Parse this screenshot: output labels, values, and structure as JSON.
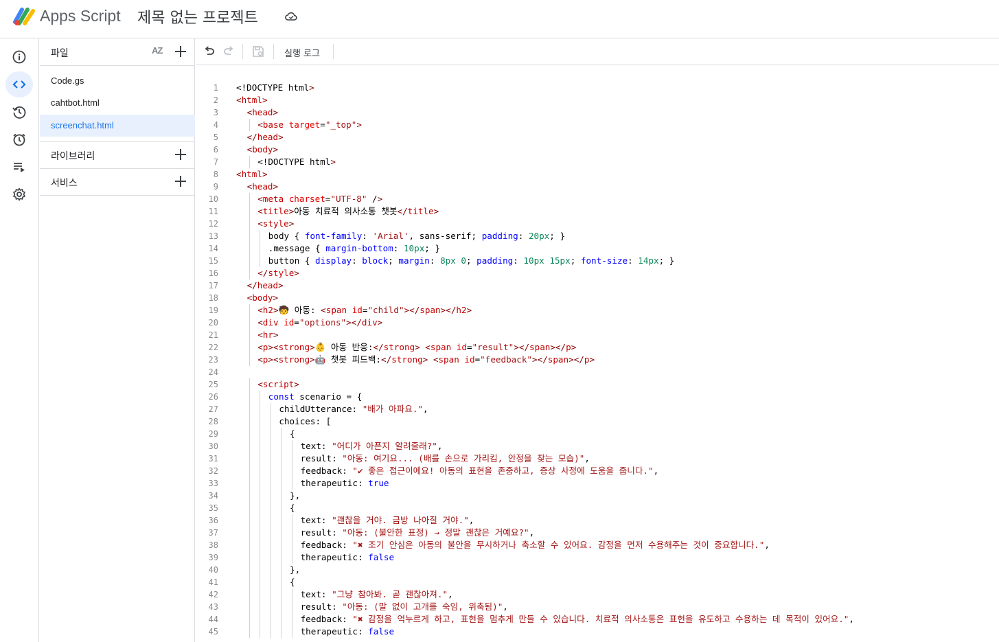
{
  "header": {
    "app_name": "Apps Script",
    "project_title": "제목 없는 프로젝트"
  },
  "rail": {
    "items": [
      {
        "name": "overview",
        "icon": "info-icon"
      },
      {
        "name": "editor",
        "icon": "code-icon",
        "active": true
      },
      {
        "name": "history",
        "icon": "history-icon"
      },
      {
        "name": "triggers",
        "icon": "alarm-icon"
      },
      {
        "name": "executions",
        "icon": "executions-icon"
      },
      {
        "name": "settings",
        "icon": "gear-icon"
      }
    ]
  },
  "files_panel": {
    "files_label": "파일",
    "sort_label": "AZ",
    "files": [
      "Code.gs",
      "cahtbot.html",
      "screenchat.html"
    ],
    "selected_file": "screenchat.html",
    "libraries_label": "라이브러리",
    "services_label": "서비스"
  },
  "toolbar": {
    "execution_log_label": "실행 로그"
  },
  "editor": {
    "lines": [
      {
        "n": "1",
        "indent": 0,
        "text": "<!DOCTYPE html>"
      },
      {
        "n": "2",
        "indent": 0,
        "text": "<html>"
      },
      {
        "n": "3",
        "indent": 1,
        "text": "<head>"
      },
      {
        "n": "4",
        "indent": 2,
        "text": "<base target=\"_top\">"
      },
      {
        "n": "5",
        "indent": 1,
        "text": "</head>"
      },
      {
        "n": "6",
        "indent": 1,
        "text": "<body>"
      },
      {
        "n": "7",
        "indent": 2,
        "text": "<!DOCTYPE html>"
      },
      {
        "n": "8",
        "indent": 0,
        "text": "<html>"
      },
      {
        "n": "9",
        "indent": 1,
        "text": "<head>"
      },
      {
        "n": "10",
        "indent": 2,
        "text": "<meta charset=\"UTF-8\" />"
      },
      {
        "n": "11",
        "indent": 2,
        "text": "<title>아동 치료적 의사소통 챗봇</title>"
      },
      {
        "n": "12",
        "indent": 2,
        "text": "<style>"
      },
      {
        "n": "13",
        "indent": 3,
        "text": "body { font-family: 'Arial', sans-serif; padding: 20px; }"
      },
      {
        "n": "14",
        "indent": 3,
        "text": ".message { margin-bottom: 10px; }"
      },
      {
        "n": "15",
        "indent": 3,
        "text": "button { display: block; margin: 8px 0; padding: 10px 15px; font-size: 14px; }"
      },
      {
        "n": "16",
        "indent": 2,
        "text": "</style>"
      },
      {
        "n": "17",
        "indent": 1,
        "text": "</head>"
      },
      {
        "n": "18",
        "indent": 1,
        "text": "<body>"
      },
      {
        "n": "19",
        "indent": 2,
        "text": "<h2>🧒 아동: <span id=\"child\"></span></h2>"
      },
      {
        "n": "20",
        "indent": 2,
        "text": "<div id=\"options\"></div>"
      },
      {
        "n": "21",
        "indent": 2,
        "text": "<hr>"
      },
      {
        "n": "22",
        "indent": 2,
        "text": "<p><strong>👶 아동 반응:</strong> <span id=\"result\"></span></p>"
      },
      {
        "n": "23",
        "indent": 2,
        "text": "<p><strong>🤖 챗봇 피드백:</strong> <span id=\"feedback\"></span></p>"
      },
      {
        "n": "24",
        "indent": 0,
        "text": ""
      },
      {
        "n": "25",
        "indent": 2,
        "text": "<script>"
      },
      {
        "n": "26",
        "indent": 3,
        "text": "const scenario = {"
      },
      {
        "n": "27",
        "indent": 4,
        "text": "childUtterance: \"배가 아파요.\","
      },
      {
        "n": "28",
        "indent": 4,
        "text": "choices: ["
      },
      {
        "n": "29",
        "indent": 5,
        "text": "{"
      },
      {
        "n": "30",
        "indent": 6,
        "text": "text: \"어디가 아픈지 알려줄래?\","
      },
      {
        "n": "31",
        "indent": 6,
        "text": "result: \"아동: 여기요... (배를 손으로 가리킴, 안정을 찾는 모습)\","
      },
      {
        "n": "32",
        "indent": 6,
        "text": "feedback: \"✔ 좋은 접근이에요! 아동의 표현을 존중하고, 증상 사정에 도움을 줍니다.\","
      },
      {
        "n": "33",
        "indent": 6,
        "text": "therapeutic: true"
      },
      {
        "n": "34",
        "indent": 5,
        "text": "},"
      },
      {
        "n": "35",
        "indent": 5,
        "text": "{"
      },
      {
        "n": "36",
        "indent": 6,
        "text": "text: \"괜찮을 거야. 금방 나아질 거야.\","
      },
      {
        "n": "37",
        "indent": 6,
        "text": "result: \"아동: (불안한 표정) → 정말 괜찮은 거예요?\","
      },
      {
        "n": "38",
        "indent": 6,
        "text": "feedback: \"✖ 조기 안심은 아동의 불안을 무시하거나 축소할 수 있어요. 감정을 먼저 수용해주는 것이 중요합니다.\","
      },
      {
        "n": "39",
        "indent": 6,
        "text": "therapeutic: false"
      },
      {
        "n": "40",
        "indent": 5,
        "text": "},"
      },
      {
        "n": "41",
        "indent": 5,
        "text": "{"
      },
      {
        "n": "42",
        "indent": 6,
        "text": "text: \"그냥 참아봐. 곧 괜찮아져.\","
      },
      {
        "n": "43",
        "indent": 6,
        "text": "result: \"아동: (말 없이 고개를 숙임, 위축됨)\","
      },
      {
        "n": "44",
        "indent": 6,
        "text": "feedback: \"✖ 감정을 억누르게 하고, 표현을 멈추게 만들 수 있습니다. 치료적 의사소통은 표현을 유도하고 수용하는 데 목적이 있어요.\","
      },
      {
        "n": "45",
        "indent": 6,
        "text": "therapeutic: false"
      }
    ]
  },
  "colors": {
    "accent": "#1a73e8",
    "selected_bg": "#e8f0fe",
    "border": "#dadce0",
    "tag": "#800000",
    "attr": "#e50000",
    "string": "#a31515",
    "keyword": "#0000ff",
    "number": "#098658"
  }
}
